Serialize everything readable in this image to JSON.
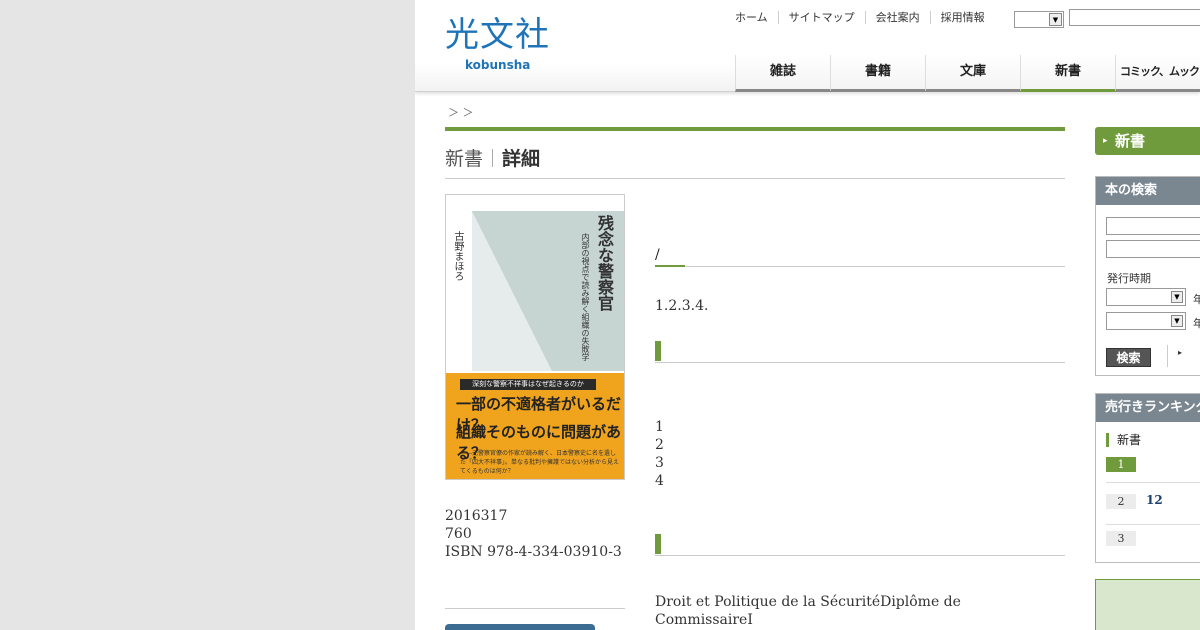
{
  "header": {
    "logo_jp": "光文社",
    "logo_en": "kobunsha",
    "utility_links": [
      "ホーム",
      "サイトマップ",
      "会社案内",
      "採用情報"
    ],
    "nav": [
      "雑誌",
      "書籍",
      "文庫",
      "新書",
      "コミック、ムックほか"
    ]
  },
  "breadcrumb": "＞ ＞",
  "page_title": {
    "category": "新書",
    "detail": "詳細"
  },
  "book": {
    "cover": {
      "author": "古野まほろ",
      "title": "残念な警察官",
      "subtitle": "内部の視点で読み解く組織の失敗学",
      "band": "深刻な警察不祥事はなぜ起きるのか",
      "line1": "一部の不適格者がいるだけ？",
      "line2": "組織そのものに問題がある？",
      "blurb": "――元警察官僚の作家が読み解く、日本警察史に名を遺した「四大不祥事」。単なる批判や擁護ではない分析から見えてくるものは何か？"
    },
    "date": "2016317",
    "price": "760",
    "isbn": "ISBN 978-4-334-03910-3"
  },
  "content": {
    "slash": "/",
    "chapters_inline": "1.2.3.4.",
    "toc": [
      "1",
      "2",
      "3",
      "4"
    ],
    "author_bio_line1": "Droit et Politique de la SécuritéDiplôme de",
    "author_bio_line2": "CommissaireI"
  },
  "sidebar": {
    "new_label": "新書",
    "search_head": "本の検索",
    "period_label": "発行時期",
    "year_suffix": "年",
    "search_button": "検索",
    "ranking_head": "売行きランキング",
    "ranking_cat": "新書",
    "ranks": [
      {
        "n": "1",
        "title": ""
      },
      {
        "n": "2",
        "title": "12"
      },
      {
        "n": "3",
        "title": ""
      }
    ]
  },
  "colors": {
    "brand_blue": "#1f73b7",
    "accent_green": "#6f9b3c",
    "box_head": "#7a8791"
  }
}
